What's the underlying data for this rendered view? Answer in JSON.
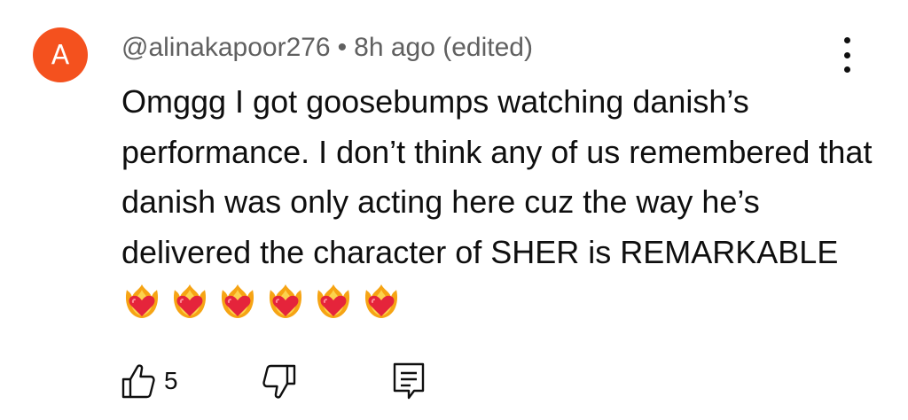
{
  "comment": {
    "avatar_letter": "A",
    "avatar_color": "#f4511e",
    "username": "@alinakapoor276",
    "separator": "•",
    "timestamp": "8h ago",
    "edited_label": "(edited)",
    "text": "Omggg I got goosebumps watching danish’s performance. I don’t think any of us remembered that danish was only acting here cuz the way he’s delivered the character of SHER is REMARKABLE",
    "emojis": [
      "heart-on-fire",
      "heart-on-fire",
      "heart-on-fire",
      "heart-on-fire",
      "heart-on-fire",
      "heart-on-fire"
    ],
    "menu_icon": "more-vert-icon"
  },
  "actions": {
    "like_icon": "thumbs-up-icon",
    "like_count": "5",
    "dislike_icon": "thumbs-down-icon",
    "reply_icon": "reply-comment-icon"
  }
}
